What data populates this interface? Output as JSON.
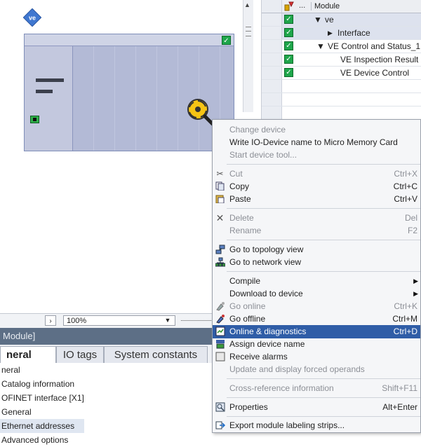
{
  "device": {
    "badge": "ve",
    "icon_names": [
      "ve-badge-icon",
      "lens-search-icon",
      "ethernet-port-icon",
      "check-icon"
    ]
  },
  "tree": {
    "header": {
      "dots": "...",
      "module": "Module"
    },
    "rows": [
      {
        "label": "ve",
        "expander": "▼",
        "selected": true
      },
      {
        "label": "Interface",
        "expander": "▶",
        "selected": true
      },
      {
        "label": "VE Control and Status_1",
        "expander": "▼",
        "selected": false
      },
      {
        "label": "VE Inspection Result",
        "expander": "",
        "selected": false
      },
      {
        "label": "VE Device Control",
        "expander": "",
        "selected": false
      }
    ]
  },
  "zoombar": {
    "arrow": "›",
    "zoom": "100%",
    "drop": "▼"
  },
  "inspector": {
    "title": "Module]",
    "tabs": [
      {
        "label": "neral",
        "active": true
      },
      {
        "label": "IO tags",
        "active": false
      },
      {
        "label": "System constants",
        "active": false
      }
    ],
    "nav": [
      {
        "label": "neral",
        "selected": false
      },
      {
        "label": "Catalog information",
        "selected": false
      },
      {
        "label": "OFINET interface [X1]",
        "selected": false
      },
      {
        "label": "General",
        "selected": false
      },
      {
        "label": "Ethernet addresses",
        "selected": true
      },
      {
        "label": "Advanced options",
        "selected": false
      }
    ]
  },
  "menu": {
    "items": [
      {
        "text": "Change device",
        "shortcut": "",
        "disabled": true,
        "icon": ""
      },
      {
        "text": "Write IO-Device name to Micro Memory Card",
        "shortcut": "",
        "disabled": false,
        "icon": ""
      },
      {
        "text": "Start device tool...",
        "shortcut": "",
        "disabled": true,
        "icon": ""
      },
      {
        "text": "Cut",
        "shortcut": "Ctrl+X",
        "disabled": true,
        "icon": "scissors-icon"
      },
      {
        "text": "Copy",
        "shortcut": "Ctrl+C",
        "disabled": false,
        "icon": "copy-icon"
      },
      {
        "text": "Paste",
        "shortcut": "Ctrl+V",
        "disabled": false,
        "icon": "paste-icon"
      },
      {
        "text": "Delete",
        "shortcut": "Del",
        "disabled": true,
        "icon": "delete-icon"
      },
      {
        "text": "Rename",
        "shortcut": "F2",
        "disabled": true,
        "icon": ""
      },
      {
        "text": "Go to topology view",
        "shortcut": "",
        "disabled": false,
        "icon": "topology-icon"
      },
      {
        "text": "Go to network view",
        "shortcut": "",
        "disabled": false,
        "icon": "network-icon"
      },
      {
        "text": "Compile",
        "shortcut": "",
        "disabled": false,
        "icon": "",
        "submenu": "▶"
      },
      {
        "text": "Download to device",
        "shortcut": "",
        "disabled": false,
        "icon": "",
        "submenu": "▶"
      },
      {
        "text": "Go online",
        "shortcut": "Ctrl+K",
        "disabled": true,
        "icon": "go-online-icon"
      },
      {
        "text": "Go offline",
        "shortcut": "Ctrl+M",
        "disabled": false,
        "icon": "go-offline-icon"
      },
      {
        "text": "Online & diagnostics",
        "shortcut": "Ctrl+D",
        "disabled": false,
        "icon": "diagnostics-icon",
        "highlighted": true
      },
      {
        "text": "Assign device name",
        "shortcut": "",
        "disabled": false,
        "icon": "assign-name-icon"
      },
      {
        "text": "Receive alarms",
        "shortcut": "",
        "disabled": false,
        "icon": "alarm-checkbox-icon"
      },
      {
        "text": "Update and display forced operands",
        "shortcut": "",
        "disabled": true,
        "icon": ""
      },
      {
        "text": "Cross-reference information",
        "shortcut": "Shift+F11",
        "disabled": true,
        "icon": ""
      },
      {
        "text": "Properties",
        "shortcut": "Alt+Enter",
        "disabled": false,
        "icon": "properties-icon"
      },
      {
        "text": "Export module labeling strips...",
        "shortcut": "",
        "disabled": false,
        "icon": "export-icon"
      }
    ]
  },
  "colors": {
    "highlight": "#2f5da7",
    "check_green": "#1fa64b",
    "device_blue": "#b7bed8",
    "inspector_title": "#5d6f86"
  }
}
